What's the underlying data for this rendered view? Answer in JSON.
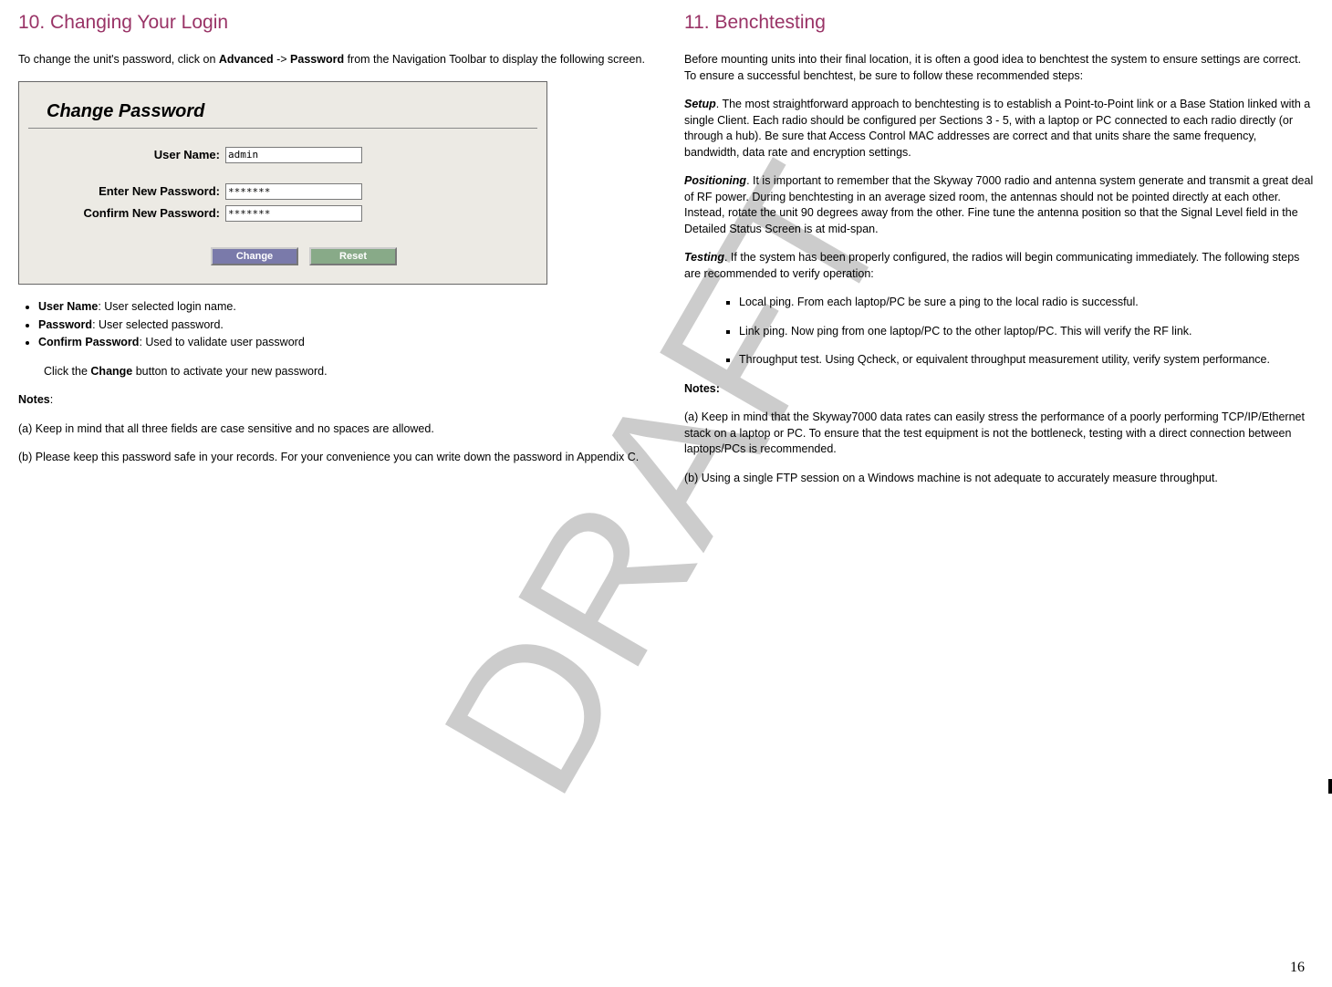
{
  "watermark": "DRAFT",
  "page_number": "16",
  "left": {
    "heading": "10. Changing Your Login",
    "intro_pre": "To change the unit's password, click on ",
    "intro_b1": "Advanced",
    "intro_mid": " -> ",
    "intro_b2": "Password",
    "intro_post": " from the Navigation Toolbar to display the following screen.",
    "panel_title": "Change Password",
    "lbl_user": "User Name:",
    "lbl_new": "Enter New Password:",
    "lbl_confirm": "Confirm New Password:",
    "val_user": "admin",
    "val_new": "*******",
    "val_confirm": "*******",
    "btn_change": "Change",
    "btn_reset": "Reset",
    "bullets": [
      {
        "b": "User Name",
        "rest": ": User selected login name."
      },
      {
        "b": "Password",
        "rest": ": User selected password."
      },
      {
        "b": "Confirm Password",
        "rest": ":  Used to validate user password"
      }
    ],
    "click_pre": "Click the ",
    "click_b": "Change",
    "click_post": " button to activate your new password.",
    "notes_label": "Notes",
    "note_a": "(a) Keep in mind that all three fields are case sensitive and no spaces are allowed.",
    "note_b": "(b) Please keep this password safe in your records.  For your convenience you can write down the password in Appendix C."
  },
  "right": {
    "heading": "11.  Benchtesting",
    "intro": "Before mounting units into their final location, it is often a good idea to benchtest the system to ensure settings are correct.  To ensure a successful benchtest, be sure to follow these recommended steps:",
    "setup_label": "Setup",
    "setup_text": ".  The most straightforward approach to benchtesting is to establish a Point-to-Point link or a Base Station linked with a single Client.  Each radio should be configured per Sections 3 - 5, with a laptop or PC connected to each radio directly (or through a hub).  Be sure that Access Control MAC addresses are correct and that units share the same frequency, bandwidth, data rate and encryption settings.",
    "pos_label": "Positioning",
    "pos_text": ".  It is important to remember that the Skyway 7000 radio and antenna system generate and transmit a great deal of RF power.  During benchtesting in an average sized room, the antennas should not be pointed directly at each other.  Instead,  rotate the unit 90 degrees away from the other.  Fine tune the antenna position so that the Signal Level field in the Detailed Status Screen is at mid-span.",
    "test_label": "Testing",
    "test_text": ".  If the system has been properly configured, the radios will begin communicating immediately.  The following steps are recommended to verify operation:",
    "steps": [
      "Local ping.  From each laptop/PC be sure a ping to the local radio is successful.",
      "Link ping.  Now ping from one laptop/PC to the other laptop/PC.  This will verify the RF link.",
      "Throughput test.  Using Qcheck, or equivalent throughput measurement utility, verify system performance."
    ],
    "notes_label": "Notes:",
    "note_a": "(a)  Keep in mind that the Skyway7000 data rates can easily stress the performance of a poorly performing TCP/IP/Ethernet stack on a laptop or PC.  To ensure that the test equipment is not the bottleneck, testing with a direct connection between laptops/PCs is recommended.",
    "note_b": "(b)  Using a single FTP session on a Windows machine is not adequate to accurately measure throughput."
  }
}
